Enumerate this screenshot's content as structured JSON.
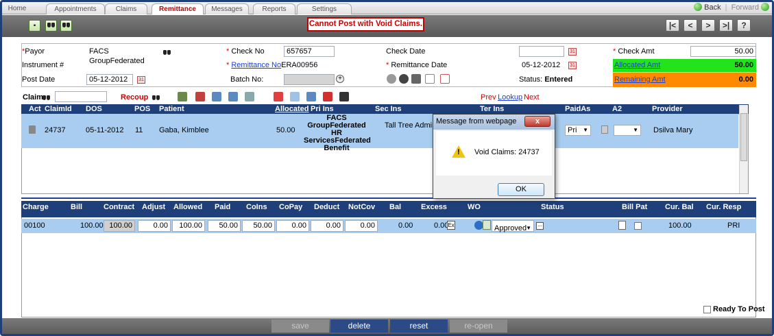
{
  "tabs": [
    "Home",
    "Appointments",
    "Claims",
    "Remittance",
    "Messages",
    "Reports",
    "Settings"
  ],
  "nav": {
    "back": "Back",
    "forward": "Forward"
  },
  "warning": "Cannot Post with Void Claims.",
  "navButtons": [
    "|<",
    "<",
    ">",
    ">|",
    "?"
  ],
  "header": {
    "payor_label": "Payor",
    "payor_value": "FACS GroupFederated",
    "instrument_label": "Instrument #",
    "postdate_label": "Post Date",
    "postdate_value": "05-12-2012",
    "checkno_label": "Check No",
    "checkno_value": "657657",
    "remitno_label": "Remittance No",
    "remitno_value": "ERA00956",
    "batchno_label": "Batch No:",
    "checkdate_label": "Check Date",
    "checkdate_value": "",
    "remitdate_label": "Remittance Date",
    "remitdate_value": "05-12-2012",
    "status_label": "Status:",
    "status_value": "Entered",
    "checkamt_label": "Check Amt",
    "checkamt_value": "50.00",
    "allocated_label": "Allocated Amt",
    "allocated_value": "50.00",
    "remaining_label": "Remaining Amt",
    "remaining_value": "0.00"
  },
  "claimbar": {
    "claim_label": "Claim",
    "recoup_label": "Recoup",
    "prev": "Prev",
    "lookup": "Lookup",
    "next": "Next"
  },
  "grid1": {
    "headers": [
      "Act",
      "ClaimId",
      "DOS",
      "POS",
      "Patient",
      "Allocated",
      "Pri Ins",
      "Sec Ins",
      "Ter Ins",
      "PaidAs",
      "A2",
      "Provider"
    ],
    "row": {
      "claimid": "24737",
      "dos": "05-11-2012",
      "pos": "11",
      "patient": "Gaba, Kimblee",
      "allocated": "50.00",
      "pri_ins": "FACS GroupFederated HR ServicesFederated Benefit",
      "sec_ins": "Tall Tree Administrator",
      "paidas": "Pri",
      "provider": "Dsilva Mary"
    }
  },
  "grid2": {
    "headers": [
      "Charge",
      "Bill",
      "Contract",
      "Adjust",
      "Allowed",
      "Paid",
      "CoIns",
      "CoPay",
      "Deduct",
      "NotCov",
      "Bal",
      "Excess",
      "WO",
      "Status",
      "Bill Pat",
      "Cur. Bal",
      "Cur. Resp"
    ],
    "row": {
      "charge": "00100",
      "bill": "100.00",
      "contract": "100.00",
      "adjust": "0.00",
      "allowed": "100.00",
      "paid": "50.00",
      "coins": "50.00",
      "copay": "0.00",
      "deduct": "0.00",
      "notcov": "0.00",
      "bal": "0.00",
      "excess": "0.00",
      "status": "Approved",
      "curbal": "100.00",
      "curresp": "PRI"
    }
  },
  "ready_label": "Ready To Post",
  "footer": {
    "save": "save",
    "delete": "delete",
    "reset": "reset",
    "reopen": "re-open"
  },
  "dialog": {
    "title": "Message from webpage",
    "close": "x",
    "message": "Void Claims: 24737",
    "ok": "OK"
  }
}
